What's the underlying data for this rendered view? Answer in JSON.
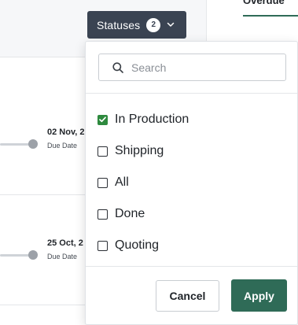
{
  "filter": {
    "button_label": "Statuses",
    "count": "2",
    "search_placeholder": "Search",
    "options": [
      {
        "label": "In Production",
        "checked": true
      },
      {
        "label": "Shipping",
        "checked": false
      },
      {
        "label": "All",
        "checked": false
      },
      {
        "label": "Done",
        "checked": false
      },
      {
        "label": "Quoting",
        "checked": false
      }
    ],
    "cancel_label": "Cancel",
    "apply_label": "Apply"
  },
  "background": {
    "tab_label": "Overdue",
    "rows": [
      {
        "date": "02 Nov, 2",
        "due_label": "Due Date"
      },
      {
        "date": "25 Oct, 2",
        "due_label": "Due Date"
      }
    ]
  },
  "colors": {
    "button_dark": "#3a4352",
    "accent_green": "#2f6b57",
    "checkbox_green": "#2e8a3e"
  }
}
